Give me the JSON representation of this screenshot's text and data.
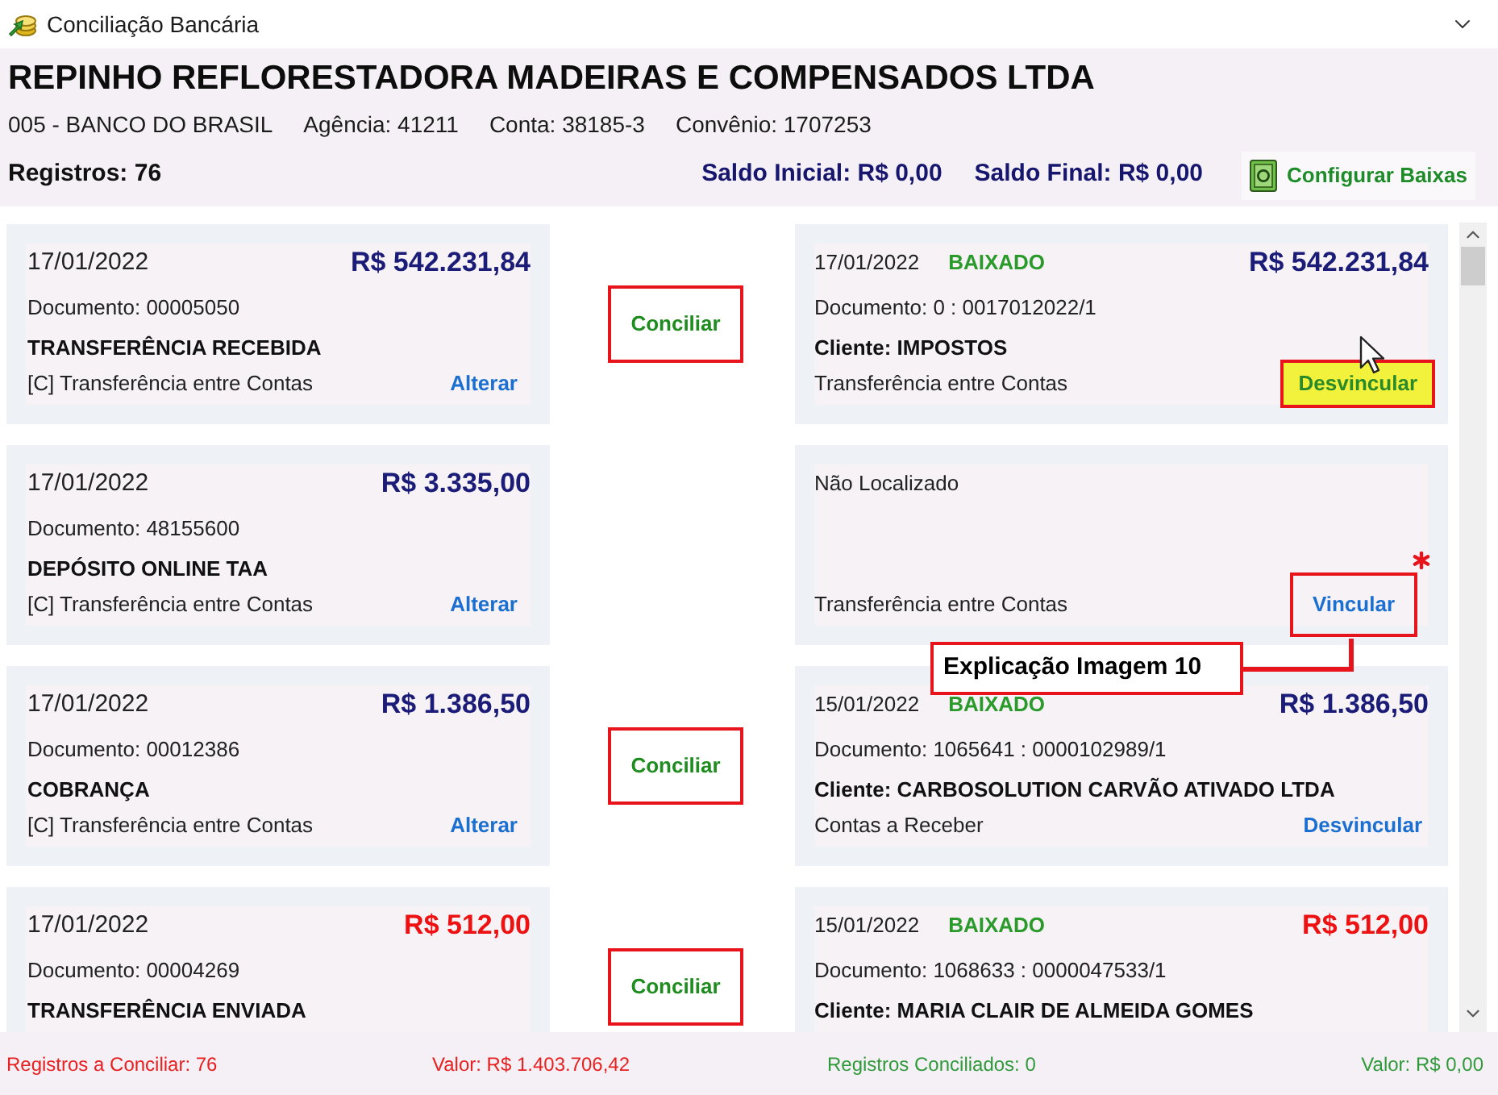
{
  "window": {
    "title": "Conciliação Bancária"
  },
  "header": {
    "company": "REPINHO REFLORESTADORA MADEIRAS E COMPENSADOS LTDA",
    "account_info": [
      "005 - BANCO DO BRASIL",
      "Agência: 41211",
      "Conta: 38185-3",
      "Convênio: 1707253"
    ],
    "records": "Registros: 76",
    "initial_balance": "Saldo Inicial: R$ 0,00",
    "final_balance": "Saldo Final: R$ 0,00",
    "configure_button": "Configurar Baixas"
  },
  "rows": [
    {
      "statement": {
        "date": "17/01/2022",
        "amount": "R$ 542.231,84",
        "debit": false,
        "document": "Documento: 00005050",
        "description": "TRANSFERÊNCIA RECEBIDA",
        "category": "[C] Transferência entre Contas",
        "action": "Alterar"
      },
      "reconcile_button": "Conciliar",
      "match": {
        "kind": "found",
        "date": "17/01/2022",
        "status": "BAIXADO",
        "amount": "R$ 542.231,84",
        "debit": false,
        "document": "Documento: 0 : 0017012022/1",
        "client": "Cliente: IMPOSTOS",
        "category": "Transferência entre Contas",
        "action": "Desvincular",
        "highlighted": true,
        "marked": false
      }
    },
    {
      "statement": {
        "date": "17/01/2022",
        "amount": "R$ 3.335,00",
        "debit": false,
        "document": "Documento: 48155600",
        "description": "DEPÓSITO ONLINE TAA",
        "category": "[C] Transferência entre Contas",
        "action": "Alterar"
      },
      "match": {
        "kind": "not_found",
        "label": "Não Localizado",
        "category": "Transferência entre Contas",
        "action": "Vincular",
        "highlighted": false,
        "marked": true
      }
    },
    {
      "statement": {
        "date": "17/01/2022",
        "amount": "R$ 1.386,50",
        "debit": false,
        "document": "Documento: 00012386",
        "description": "COBRANÇA",
        "category": "[C] Transferência entre Contas",
        "action": "Alterar"
      },
      "reconcile_button": "Conciliar",
      "match": {
        "kind": "found",
        "date": "15/01/2022",
        "status": "BAIXADO",
        "amount": "R$ 1.386,50",
        "debit": false,
        "document": "Documento: 1065641 : 0000102989/1",
        "client": "Cliente: CARBOSOLUTION CARVÃO ATIVADO LTDA",
        "category": "Contas a Receber",
        "action": "Desvincular",
        "highlighted": false,
        "marked": false
      }
    },
    {
      "statement": {
        "date": "17/01/2022",
        "amount": "R$ 512,00",
        "debit": true,
        "document": "Documento: 00004269",
        "description": "TRANSFERÊNCIA ENVIADA"
      },
      "reconcile_button": "Conciliar",
      "match": {
        "kind": "found",
        "date": "15/01/2022",
        "status": "BAIXADO",
        "amount": "R$ 512,00",
        "debit": true,
        "document": "Documento: 1068633 : 0000047533/1",
        "client": "Cliente: MARIA CLAIR DE ALMEIDA GOMES"
      }
    }
  ],
  "callout": {
    "text": "Explicação Imagem 10"
  },
  "footer": {
    "pending_records": "Registros a Conciliar: 76",
    "pending_value": "Valor: R$ 1.403.706,42",
    "reconciled_records": "Registros Conciliados: 0",
    "reconciled_value": "Valor: R$ 0,00"
  }
}
